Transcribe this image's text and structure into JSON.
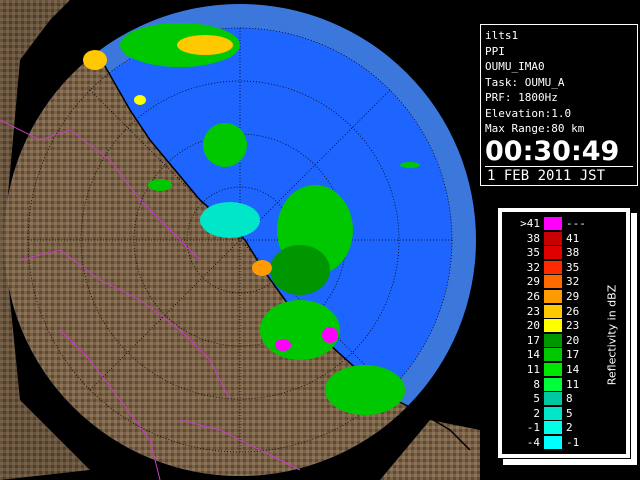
{
  "info": {
    "site": "ilts1",
    "product": "PPI",
    "station": "OUMU_IMA0",
    "task": "Task: OUMU_A",
    "prf": "PRF: 1800Hz",
    "elevation": "Elevation:1.0",
    "max_range": "Max Range:80 km",
    "time": "00:30:49",
    "date": "1 FEB 2011 JST"
  },
  "legend": {
    "title": "Reflectivity in dBZ",
    "rows": [
      {
        "lo": ">41",
        "hi": "---",
        "color": "#ff00ff"
      },
      {
        "lo": "38",
        "hi": "41",
        "color": "#c80000"
      },
      {
        "lo": "35",
        "hi": "38",
        "color": "#e00000"
      },
      {
        "lo": "32",
        "hi": "35",
        "color": "#ff2a00"
      },
      {
        "lo": "29",
        "hi": "32",
        "color": "#ff6a00"
      },
      {
        "lo": "26",
        "hi": "29",
        "color": "#ff9a00"
      },
      {
        "lo": "23",
        "hi": "26",
        "color": "#ffc800"
      },
      {
        "lo": "20",
        "hi": "23",
        "color": "#ffff00"
      },
      {
        "lo": "17",
        "hi": "20",
        "color": "#009600"
      },
      {
        "lo": "14",
        "hi": "17",
        "color": "#00c800"
      },
      {
        "lo": "11",
        "hi": "14",
        "color": "#00e600"
      },
      {
        "lo": "8",
        "hi": "11",
        "color": "#00ff3a"
      },
      {
        "lo": "5",
        "hi": "8",
        "color": "#00c8a0"
      },
      {
        "lo": "2",
        "hi": "5",
        "color": "#00e6c8"
      },
      {
        "lo": "-1",
        "hi": "2",
        "color": "#00ffe6"
      },
      {
        "lo": "-4",
        "hi": "-1",
        "color": "#00ffff"
      }
    ]
  },
  "colors": {
    "background": "#000000",
    "radar_coverage": "#1e64ff",
    "outer_ring": "#3c78dc",
    "terrain": "#786048",
    "prefecture_border": "#c83cc8",
    "coastline": "#000000",
    "range_ring": "#000000"
  }
}
